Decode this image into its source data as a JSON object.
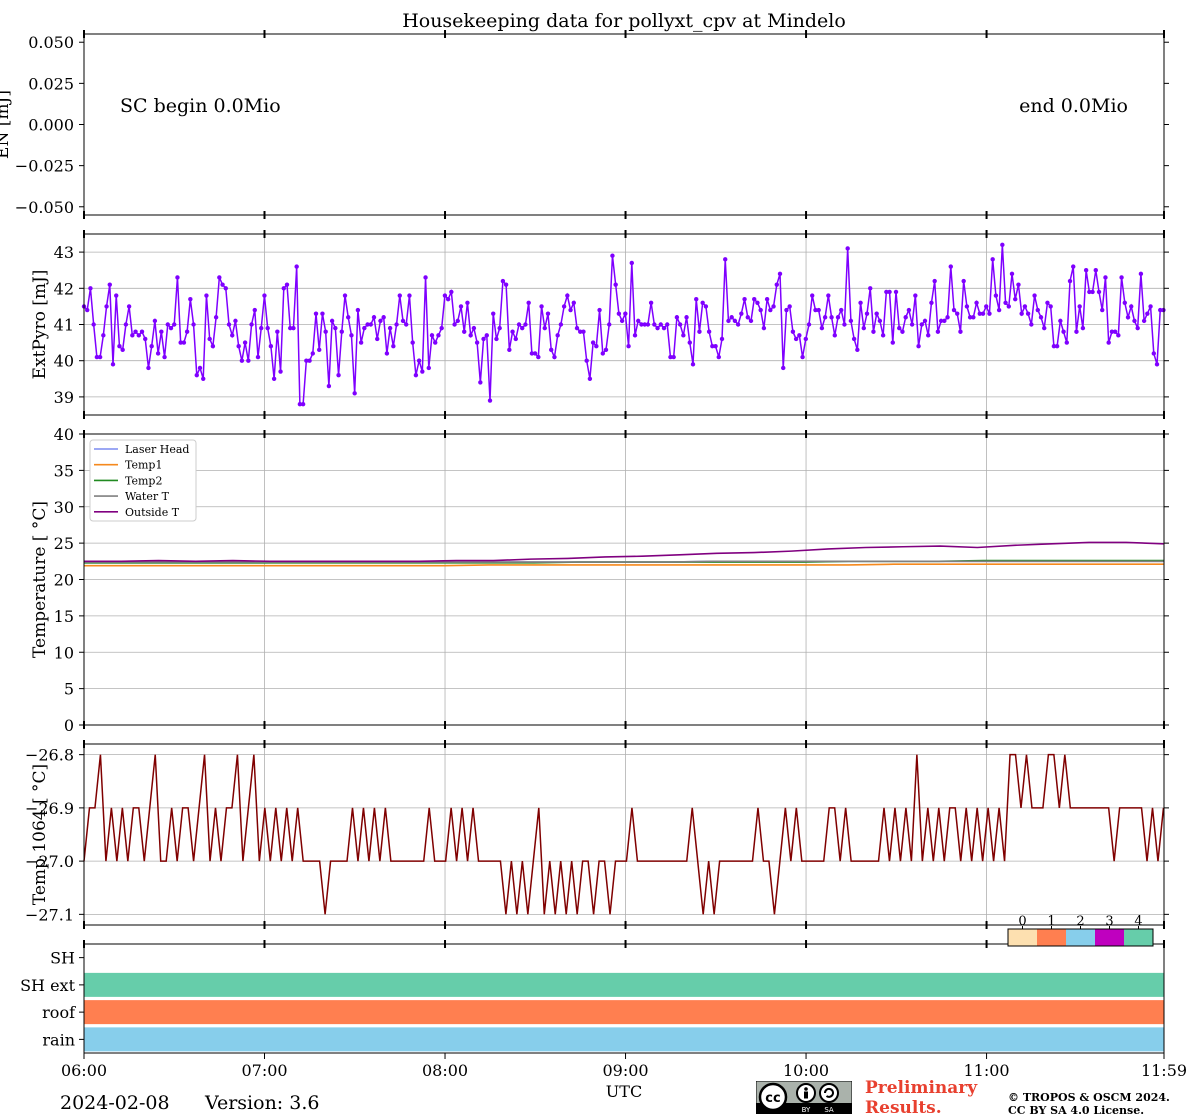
{
  "figure_title": "Housekeeping data for pollyxt_cpv at Mindelo",
  "footer": {
    "date": "2024-02-08",
    "version": "Version: 3.6",
    "preliminary_line1": "Preliminary",
    "preliminary_line2": "Results.",
    "copyright_line1": "© TROPOS & OSCM 2024.",
    "copyright_line2": "CC BY SA 4.0 License.",
    "cc_badge_text": [
      "BY",
      "SA"
    ]
  },
  "chart_data": [
    {
      "type": "line",
      "id": "energy",
      "title": "Housekeeping data for pollyxt_cpv at Mindelo",
      "ylabel": "EN [mJ]",
      "ylim": [
        -0.055,
        0.055
      ],
      "yticks": [
        -0.05,
        -0.025,
        0.0,
        0.025,
        0.05
      ],
      "ytick_labels": [
        "−0.050",
        "−0.025",
        "0.000",
        "0.025",
        "0.050"
      ],
      "grid": false,
      "annotations": [
        "SC begin 0.0Mio",
        "end 0.0Mio"
      ],
      "series": []
    },
    {
      "type": "line",
      "id": "extpyro",
      "ylabel": "ExtPyro [mJ]",
      "ylim": [
        38.5,
        43.5
      ],
      "yticks": [
        39,
        40,
        41,
        42,
        43
      ],
      "ytick_labels": [
        "39",
        "40",
        "41",
        "42",
        "43"
      ],
      "grid": true,
      "color": "#7f00ff",
      "x_start_hours": 6.0,
      "x_end_hours": 11.98,
      "values": [
        41.5,
        41.4,
        42.0,
        41.0,
        40.1,
        40.1,
        40.7,
        41.5,
        42.1,
        39.9,
        41.8,
        40.4,
        40.3,
        41.0,
        41.5,
        40.7,
        40.8,
        40.7,
        40.8,
        40.6,
        39.8,
        40.4,
        41.1,
        40.2,
        40.8,
        40.1,
        41.0,
        40.9,
        41.0,
        42.3,
        40.5,
        40.5,
        40.8,
        41.7,
        41.0,
        39.6,
        39.8,
        39.5,
        41.8,
        40.6,
        40.4,
        41.2,
        42.3,
        42.1,
        42.0,
        41.0,
        40.7,
        41.1,
        40.4,
        40.0,
        40.5,
        40.0,
        41.0,
        41.4,
        40.1,
        40.9,
        41.8,
        40.9,
        40.4,
        39.5,
        40.8,
        39.7,
        42.0,
        42.1,
        40.9,
        40.9,
        42.6,
        38.8,
        38.8,
        40.0,
        40.0,
        40.2,
        41.3,
        40.3,
        41.3,
        40.8,
        39.3,
        41.1,
        40.9,
        39.6,
        40.8,
        41.8,
        41.2,
        40.7,
        39.1,
        41.4,
        40.5,
        40.9,
        41.0,
        41.0,
        41.2,
        40.6,
        41.1,
        41.2,
        40.2,
        40.9,
        40.4,
        41.0,
        41.8,
        41.1,
        41.0,
        41.8,
        40.5,
        39.6,
        40.0,
        39.7,
        42.3,
        39.8,
        40.7,
        40.5,
        40.7,
        40.9,
        41.8,
        41.7,
        41.9,
        41.0,
        41.1,
        41.5,
        40.8,
        41.6,
        40.7,
        40.9,
        40.5,
        39.4,
        40.6,
        40.7,
        38.9,
        41.3,
        40.6,
        40.9,
        42.2,
        42.1,
        40.3,
        40.8,
        40.6,
        41.0,
        40.9,
        41.0,
        41.6,
        40.2,
        40.2,
        40.1,
        41.5,
        40.9,
        41.3,
        40.3,
        40.1,
        40.7,
        41.0,
        41.5,
        41.8,
        41.4,
        41.6,
        40.9,
        40.8,
        40.8,
        40.0,
        39.5,
        40.5,
        40.4,
        41.4,
        40.2,
        40.3,
        41.0,
        42.9,
        42.1,
        41.3,
        41.1,
        41.3,
        40.4,
        42.7,
        40.7,
        41.1,
        41.0,
        41.0,
        41.0,
        41.6,
        41.0,
        40.9,
        41.0,
        40.9,
        41.0,
        40.1,
        40.1,
        41.2,
        41.0,
        40.7,
        41.2,
        40.5,
        39.9,
        41.7,
        40.8,
        41.6,
        41.5,
        40.8,
        40.4,
        40.4,
        40.1,
        40.6,
        42.8,
        41.1,
        41.2,
        41.1,
        41.0,
        41.3,
        41.7,
        41.2,
        41.1,
        41.7,
        41.6,
        41.4,
        40.9,
        41.7,
        41.4,
        41.5,
        42.1,
        42.4,
        39.8,
        41.4,
        41.5,
        40.8,
        40.6,
        40.7,
        40.1,
        40.6,
        41.0,
        41.8,
        41.4,
        41.4,
        40.9,
        41.2,
        41.8,
        41.2,
        40.7,
        41.2,
        41.4,
        41.0,
        43.1,
        41.1,
        40.6,
        40.3,
        41.6,
        40.9,
        41.3,
        42.0,
        40.8,
        41.3,
        41.1,
        40.7,
        41.9,
        41.9,
        40.5,
        41.9,
        40.9,
        40.8,
        41.2,
        41.4,
        41.0,
        41.8,
        40.4,
        41.0,
        41.1,
        40.7,
        41.6,
        42.2,
        40.8,
        41.1,
        41.1,
        41.2,
        42.6,
        41.4,
        41.3,
        40.8,
        42.2,
        41.5,
        41.2,
        41.2,
        41.6,
        41.3,
        41.3,
        41.5,
        41.3,
        42.8,
        41.8,
        41.4,
        43.2,
        41.6,
        41.5,
        42.4,
        41.7,
        42.1,
        41.3,
        41.5,
        41.3,
        41.0,
        41.8,
        41.4,
        41.2,
        40.9,
        41.6,
        41.5,
        40.4,
        40.4,
        41.1,
        40.8,
        40.5,
        42.2,
        42.6,
        40.8,
        41.5,
        40.9,
        42.5,
        41.9,
        41.9,
        42.5,
        41.9,
        41.4,
        42.3,
        40.5,
        40.8,
        40.8,
        40.7,
        42.3,
        41.6,
        41.2,
        41.5,
        41.1,
        40.9,
        42.4,
        41.1,
        41.3,
        41.5,
        40.2,
        39.9,
        41.4,
        41.4
      ],
      "series": [
        {
          "name": "",
          "color": "#7f00ff"
        }
      ]
    },
    {
      "type": "line",
      "id": "temperature",
      "ylabel": "Temperature [$^\\circ C$]",
      "ylabel_display": "Temperature [ °C]",
      "ylim": [
        0,
        40
      ],
      "yticks": [
        0,
        5,
        10,
        15,
        20,
        25,
        30,
        35,
        40
      ],
      "ytick_labels": [
        "0",
        "5",
        "10",
        "15",
        "20",
        "25",
        "30",
        "35",
        "40"
      ],
      "grid": true,
      "legend": "top-left",
      "x_start_hours": 6.0,
      "x_end_hours": 11.98,
      "series": [
        {
          "name": "Laser Head",
          "color": "#7b8cf0",
          "values": [
            22.3,
            22.3,
            22.3,
            22.3,
            22.3,
            22.4,
            22.4,
            22.4,
            22.4,
            22.4,
            22.4,
            22.4,
            22.4,
            22.4,
            22.5,
            22.5,
            22.5,
            22.5,
            22.5,
            22.5,
            22.5,
            22.5,
            22.5,
            22.5,
            22.5
          ]
        },
        {
          "name": "Temp1",
          "color": "#f5891d",
          "values": [
            21.9,
            21.9,
            21.9,
            21.9,
            21.9,
            21.9,
            21.9,
            21.9,
            21.9,
            22.0,
            22.0,
            22.0,
            22.0,
            22.0,
            22.0,
            22.0,
            22.0,
            22.0,
            22.1,
            22.1,
            22.1,
            22.1,
            22.1,
            22.1,
            22.1
          ]
        },
        {
          "name": "Temp2",
          "color": "#218a21",
          "values": [
            22.3,
            22.3,
            22.3,
            22.3,
            22.3,
            22.3,
            22.3,
            22.3,
            22.3,
            22.3,
            22.3,
            22.4,
            22.4,
            22.4,
            22.4,
            22.4,
            22.4,
            22.5,
            22.5,
            22.5,
            22.6,
            22.6,
            22.6,
            22.6,
            22.6
          ]
        },
        {
          "name": "Water T",
          "color": "#808080",
          "values": [
            22.4,
            22.4,
            22.4,
            22.4,
            22.4,
            22.4,
            22.4,
            22.4,
            22.4,
            22.4,
            22.4,
            22.4,
            22.4,
            22.4,
            22.5,
            22.5,
            22.5,
            22.5,
            22.5,
            22.5,
            22.5,
            22.5,
            22.5,
            22.5,
            22.5
          ]
        },
        {
          "name": "Outside T",
          "color": "#800080",
          "values": [
            22.5,
            22.5,
            22.6,
            22.5,
            22.6,
            22.5,
            22.5,
            22.5,
            22.5,
            22.5,
            22.6,
            22.6,
            22.8,
            22.9,
            23.1,
            23.2,
            23.4,
            23.6,
            23.7,
            23.9,
            24.2,
            24.4,
            24.5,
            24.6,
            24.4,
            24.7,
            24.9,
            25.1,
            25.1,
            24.9
          ]
        }
      ]
    },
    {
      "type": "line",
      "id": "temp1064",
      "ylabel": "Temp 1064 [$^\\circ C$]",
      "ylabel_display": "Temp 1064 [ °C]",
      "ylim": [
        -27.12,
        -26.78
      ],
      "yticks": [
        -27.1,
        -27.0,
        -26.9,
        -26.8
      ],
      "ytick_labels": [
        "−27.1",
        "−27.0",
        "−26.9",
        "−26.8"
      ],
      "grid": true,
      "color": "#800000",
      "x_start_hours": 6.0,
      "x_end_hours": 11.98,
      "values": [
        -27.0,
        -26.9,
        -26.9,
        -26.8,
        -27.0,
        -26.9,
        -27.0,
        -26.9,
        -27.0,
        -26.9,
        -26.9,
        -27.0,
        -26.9,
        -26.8,
        -27.0,
        -27.0,
        -26.9,
        -27.0,
        -26.9,
        -26.9,
        -27.0,
        -26.9,
        -26.8,
        -27.0,
        -26.9,
        -27.0,
        -26.9,
        -26.9,
        -26.8,
        -27.0,
        -26.9,
        -26.8,
        -27.0,
        -26.9,
        -27.0,
        -26.9,
        -27.0,
        -26.9,
        -27.0,
        -26.9,
        -27.0,
        -27.0,
        -27.0,
        -27.0,
        -27.1,
        -27.0,
        -27.0,
        -27.0,
        -27.0,
        -26.9,
        -27.0,
        -26.9,
        -27.0,
        -26.9,
        -27.0,
        -26.9,
        -27.0,
        -27.0,
        -27.0,
        -27.0,
        -27.0,
        -27.0,
        -27.0,
        -26.9,
        -27.0,
        -27.0,
        -27.0,
        -26.9,
        -27.0,
        -26.9,
        -27.0,
        -26.9,
        -27.0,
        -27.0,
        -27.0,
        -27.0,
        -27.0,
        -27.1,
        -27.0,
        -27.1,
        -27.0,
        -27.1,
        -27.0,
        -26.9,
        -27.1,
        -27.0,
        -27.1,
        -27.0,
        -27.1,
        -27.0,
        -27.1,
        -27.0,
        -27.0,
        -27.1,
        -27.0,
        -27.0,
        -27.1,
        -27.0,
        -27.0,
        -27.0,
        -26.9,
        -27.0,
        -27.0,
        -27.0,
        -27.0,
        -27.0,
        -27.0,
        -27.0,
        -27.0,
        -27.0,
        -27.0,
        -26.9,
        -27.0,
        -27.1,
        -27.0,
        -27.1,
        -27.0,
        -27.0,
        -27.0,
        -27.0,
        -27.0,
        -27.0,
        -27.0,
        -26.9,
        -27.0,
        -27.0,
        -27.1,
        -27.0,
        -26.9,
        -27.0,
        -26.9,
        -27.0,
        -27.0,
        -27.0,
        -27.0,
        -27.0,
        -26.9,
        -26.9,
        -27.0,
        -26.9,
        -27.0,
        -27.0,
        -27.0,
        -27.0,
        -27.0,
        -27.0,
        -26.9,
        -27.0,
        -26.9,
        -27.0,
        -26.9,
        -27.0,
        -26.8,
        -27.0,
        -26.9,
        -27.0,
        -26.9,
        -27.0,
        -26.9,
        -26.9,
        -27.0,
        -26.9,
        -27.0,
        -26.9,
        -27.0,
        -26.9,
        -27.0,
        -26.9,
        -27.0,
        -26.8,
        -26.8,
        -26.9,
        -26.8,
        -26.9,
        -26.9,
        -26.9,
        -26.8,
        -26.8,
        -26.9,
        -26.8,
        -26.9,
        -26.9,
        -26.9,
        -26.9,
        -26.9,
        -26.9,
        -26.9,
        -26.9,
        -27.0,
        -26.9,
        -26.9,
        -26.9,
        -26.9,
        -26.9,
        -27.0,
        -26.9,
        -27.0,
        -26.9
      ]
    },
    {
      "type": "heatmap",
      "id": "status",
      "categories": [
        "SH",
        "SH ext",
        "roof",
        "rain"
      ],
      "colorbar_ticks": [
        "0",
        "1",
        "2",
        "3",
        "4"
      ],
      "colorbar_colors": [
        "#fde0b0",
        "#ff7f50",
        "#87ceeb",
        "#bf00bf",
        "#66cdaa"
      ],
      "rows": [
        {
          "name": "SH",
          "level": null
        },
        {
          "name": "SH ext",
          "level": 4
        },
        {
          "name": "roof",
          "level": 1
        },
        {
          "name": "rain",
          "level": 2
        }
      ],
      "xlabel": "UTC",
      "xtick_labels": [
        "06:00",
        "07:00",
        "08:00",
        "09:00",
        "10:00",
        "11:00",
        "11:59"
      ],
      "xlim_hours": [
        6.0,
        11.983
      ]
    }
  ]
}
